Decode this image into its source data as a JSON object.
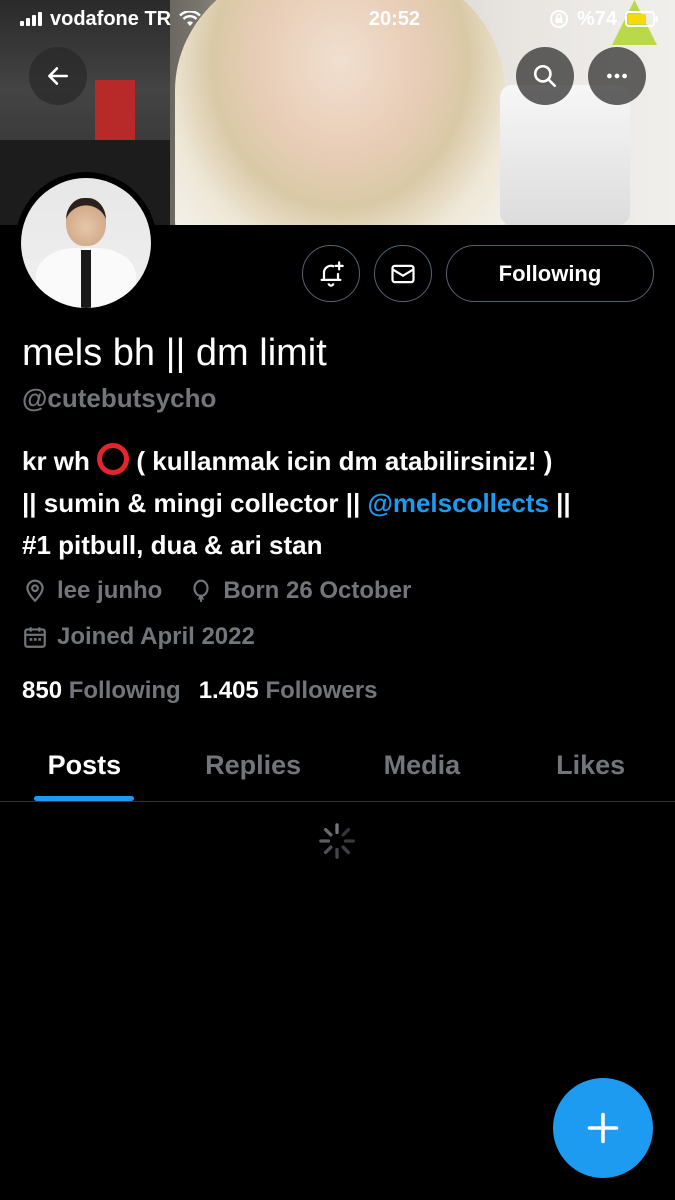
{
  "status_bar": {
    "carrier": "vodafone TR",
    "time": "20:52",
    "battery": "%74",
    "battery_level": 0.74
  },
  "header": {
    "back_icon": "arrow-left-icon",
    "search_icon": "search-icon",
    "more_icon": "more-horizontal-icon"
  },
  "actions": {
    "notify_icon": "bell-plus-icon",
    "dm_icon": "envelope-icon",
    "follow_label": "Following"
  },
  "profile": {
    "display_name": "mels bh || dm limit",
    "handle": "@cutebutsycho",
    "bio_line1_a": "kr wh",
    "bio_line1_b": " ( kullanmak icin dm atabilirsiniz! )",
    "bio_line2_a": "|| sumin & mingi collector || ",
    "bio_mention": "@melscollects",
    "bio_line2_b": " ||",
    "bio_line3": "#1 pitbull, dua & ari stan",
    "location": "lee junho",
    "birthday": "Born 26 October",
    "joined": "Joined April 2022"
  },
  "stats": {
    "following_count": "850",
    "following_label": "Following",
    "followers_count": "1.405",
    "followers_label": "Followers"
  },
  "tabs": [
    {
      "label": "Posts",
      "active": true
    },
    {
      "label": "Replies",
      "active": false
    },
    {
      "label": "Media",
      "active": false
    },
    {
      "label": "Likes",
      "active": false
    }
  ],
  "colors": {
    "accent": "#1d9bf0",
    "muted": "#71767b",
    "background": "#000000"
  }
}
